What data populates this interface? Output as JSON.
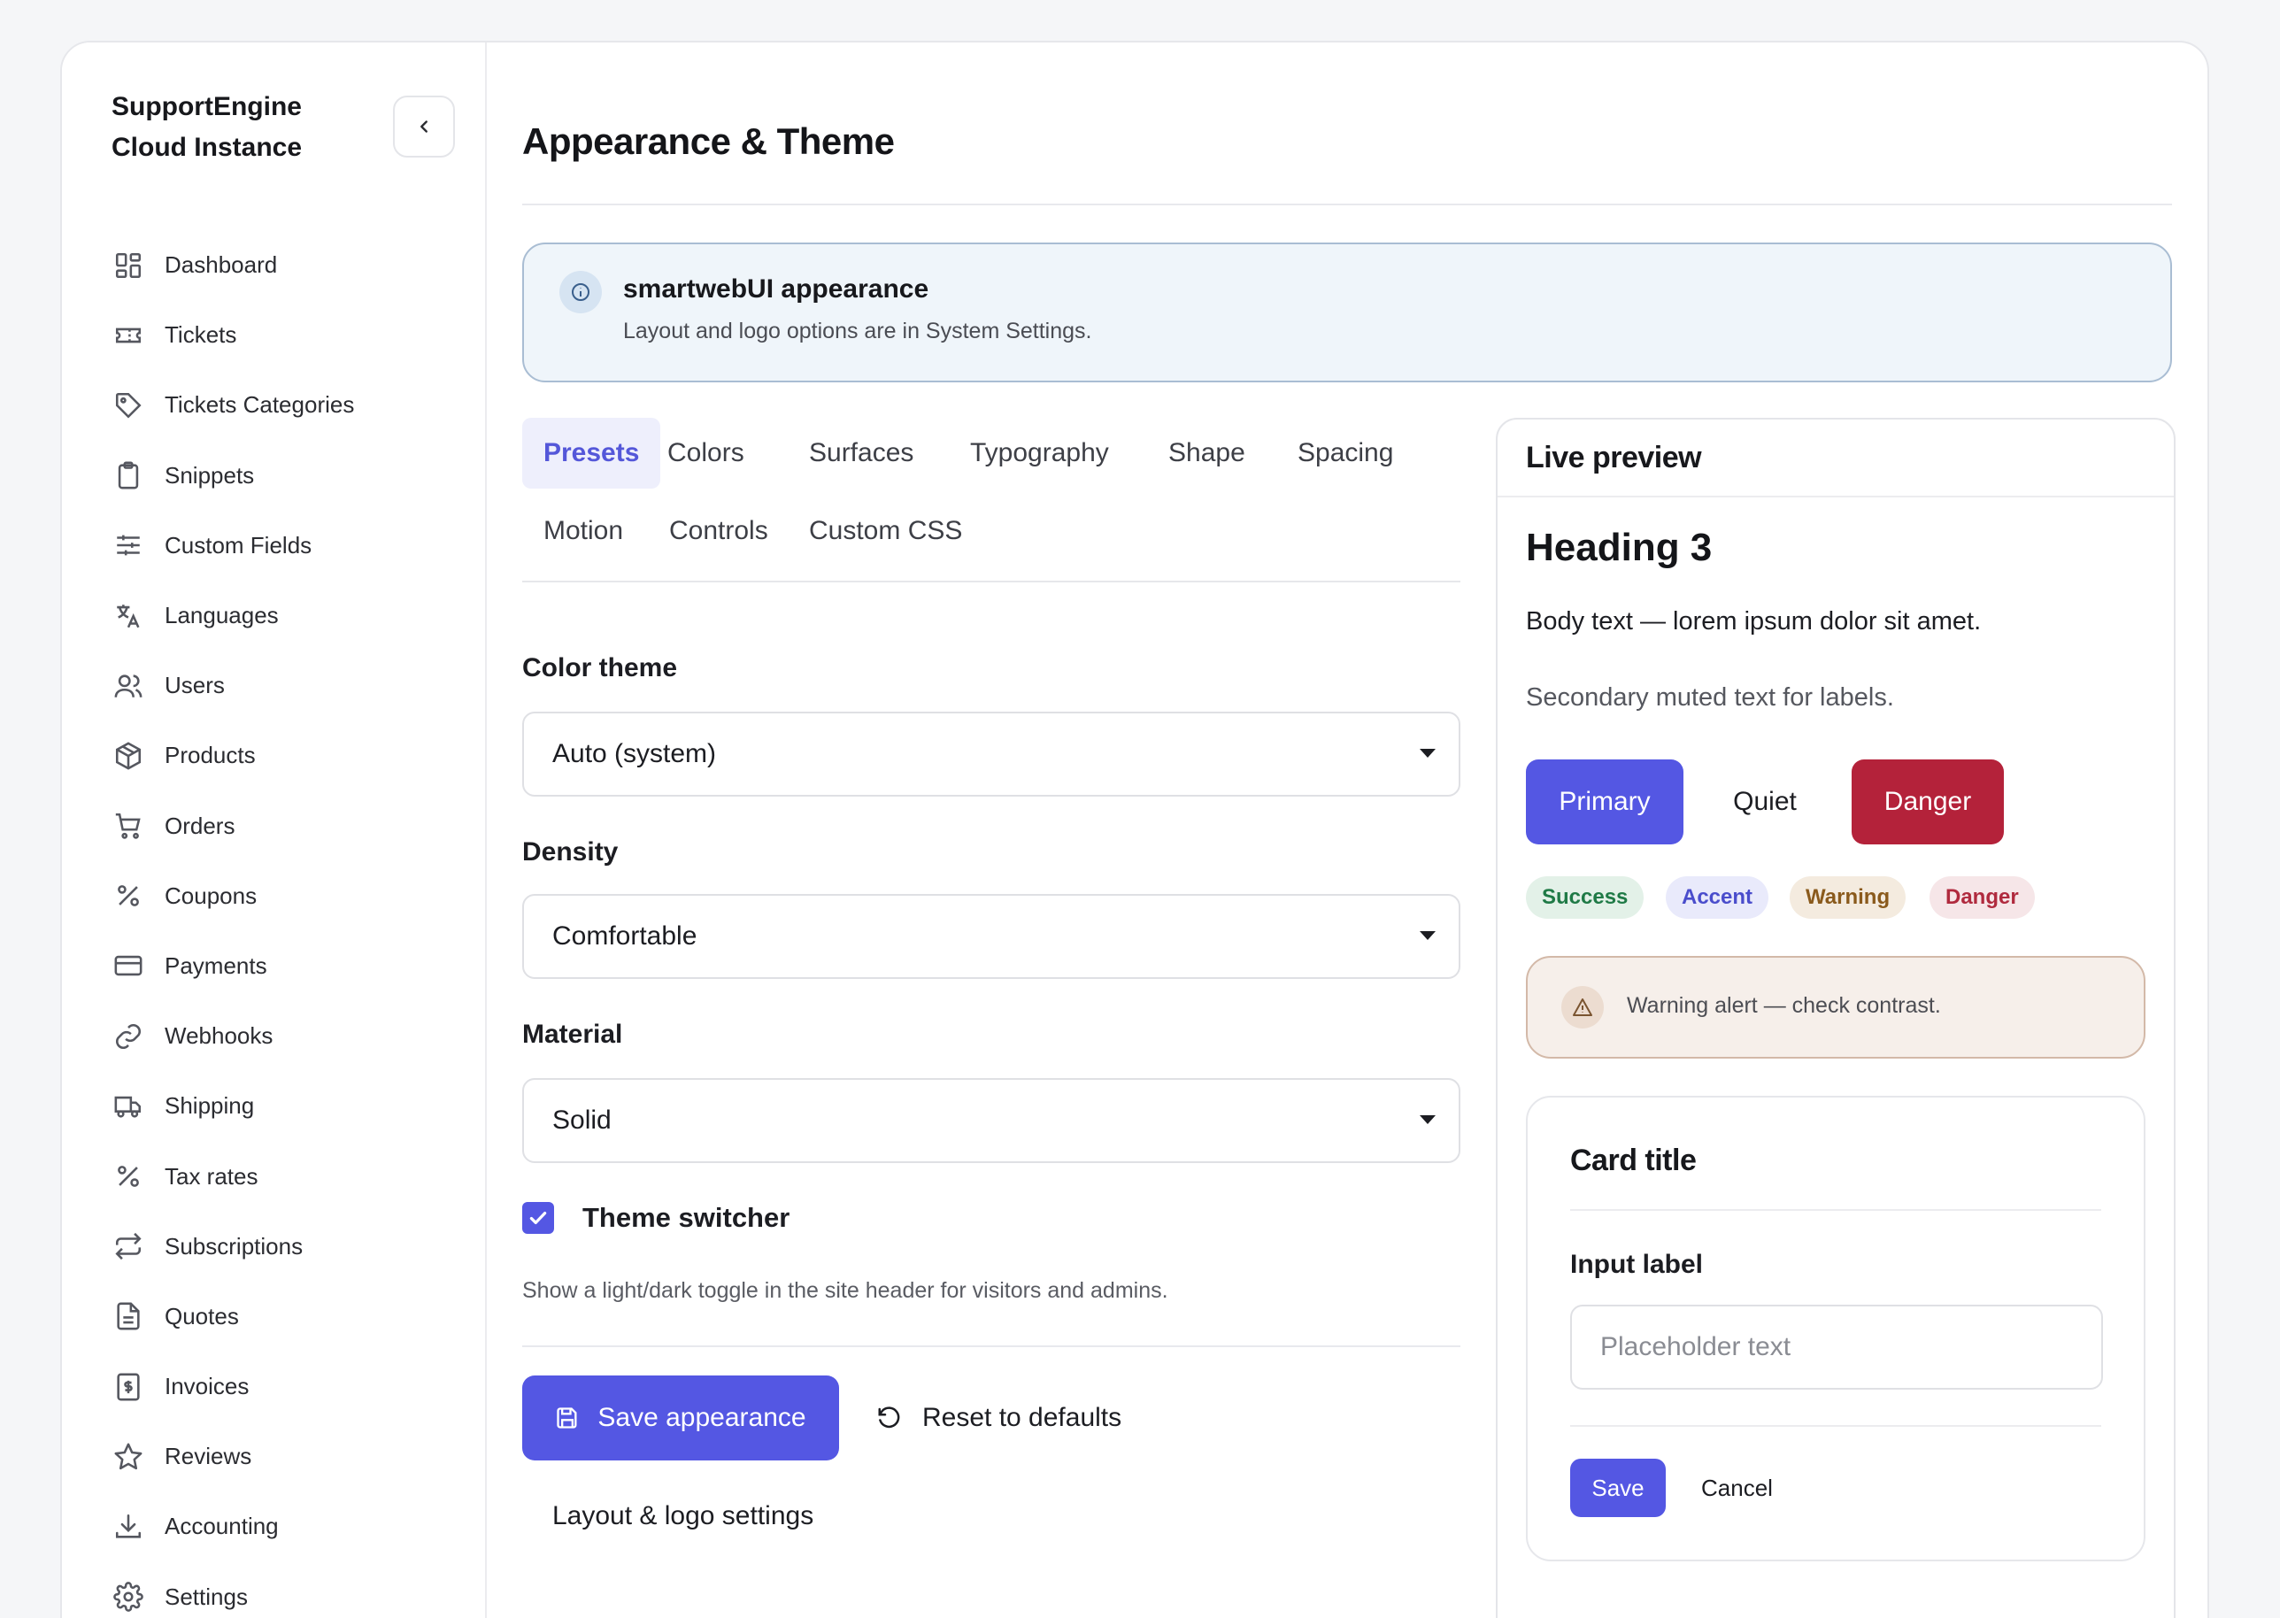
{
  "sidebar": {
    "brand_line1": "SupportEngine",
    "brand_line2": "Cloud Instance",
    "items": [
      {
        "label": "Dashboard",
        "icon": "dashboard-icon"
      },
      {
        "label": "Tickets",
        "icon": "ticket-icon"
      },
      {
        "label": "Tickets Categories",
        "icon": "tag-icon"
      },
      {
        "label": "Snippets",
        "icon": "clipboard-icon"
      },
      {
        "label": "Custom Fields",
        "icon": "sliders-icon"
      },
      {
        "label": "Languages",
        "icon": "translate-icon"
      },
      {
        "label": "Users",
        "icon": "users-icon"
      },
      {
        "label": "Products",
        "icon": "package-icon"
      },
      {
        "label": "Orders",
        "icon": "cart-icon"
      },
      {
        "label": "Coupons",
        "icon": "percent-icon"
      },
      {
        "label": "Payments",
        "icon": "credit-card-icon"
      },
      {
        "label": "Webhooks",
        "icon": "link-icon"
      },
      {
        "label": "Shipping",
        "icon": "truck-icon"
      },
      {
        "label": "Tax rates",
        "icon": "percent-icon"
      },
      {
        "label": "Subscriptions",
        "icon": "repeat-icon"
      },
      {
        "label": "Quotes",
        "icon": "document-icon"
      },
      {
        "label": "Invoices",
        "icon": "invoice-icon"
      },
      {
        "label": "Reviews",
        "icon": "star-icon"
      },
      {
        "label": "Accounting",
        "icon": "download-icon"
      },
      {
        "label": "Settings",
        "icon": "gear-icon"
      }
    ]
  },
  "page": {
    "title": "Appearance & Theme"
  },
  "banner": {
    "title": "smartwebUI appearance",
    "text": "Layout and logo options are in System Settings."
  },
  "tabs": [
    {
      "label": "Presets",
      "active": true
    },
    {
      "label": "Colors"
    },
    {
      "label": "Surfaces"
    },
    {
      "label": "Typography"
    },
    {
      "label": "Shape"
    },
    {
      "label": "Spacing"
    },
    {
      "label": "Motion"
    },
    {
      "label": "Controls"
    },
    {
      "label": "Custom CSS"
    }
  ],
  "form": {
    "color_theme_label": "Color theme",
    "color_theme_value": "Auto (system)",
    "density_label": "Density",
    "density_value": "Comfortable",
    "material_label": "Material",
    "material_value": "Solid",
    "theme_switcher_label": "Theme switcher",
    "theme_switcher_checked": true,
    "theme_switcher_help": "Show a light/dark toggle in the site header for visitors and admins.",
    "save_label": "Save appearance",
    "reset_label": "Reset to defaults",
    "layout_link": "Layout & logo settings"
  },
  "preview": {
    "header": "Live preview",
    "heading": "Heading 3",
    "body": "Body text — lorem ipsum dolor sit amet.",
    "muted": "Secondary muted text for labels.",
    "buttons": {
      "primary": "Primary",
      "quiet": "Quiet",
      "danger": "Danger"
    },
    "badges": {
      "success": "Success",
      "accent": "Accent",
      "warning": "Warning",
      "danger": "Danger"
    },
    "alert": "Warning alert — check contrast.",
    "card": {
      "title": "Card title",
      "input_label": "Input label",
      "input_placeholder": "Placeholder text",
      "save": "Save",
      "cancel": "Cancel"
    }
  },
  "colors": {
    "accent": "#5457e3",
    "danger": "#b4223a",
    "info_bg": "#eff5fa",
    "warning_bg": "#f6efea"
  }
}
